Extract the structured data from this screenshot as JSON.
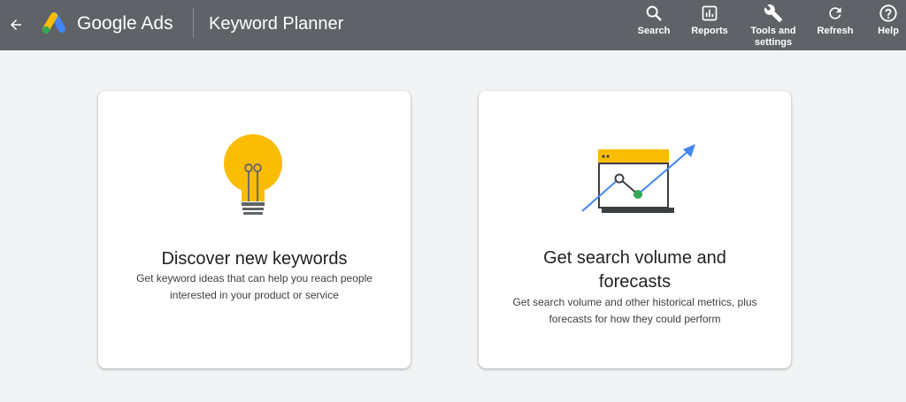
{
  "header": {
    "brand": "Google Ads",
    "page_title": "Keyword Planner",
    "tools": [
      {
        "label": "Search",
        "icon": "search-icon"
      },
      {
        "label": "Reports",
        "icon": "reports-icon"
      },
      {
        "label": "Tools and\nsettings",
        "icon": "wrench-icon"
      },
      {
        "label": "Refresh",
        "icon": "refresh-icon"
      },
      {
        "label": "Help",
        "icon": "help-icon"
      }
    ]
  },
  "cards": [
    {
      "title": "Discover new keywords",
      "description": "Get keyword ideas that can help you reach people interested in your product or service",
      "icon": "lightbulb-icon"
    },
    {
      "title": "Get search volume and forecasts",
      "description": "Get search volume and other historical metrics, plus forecasts for how they could perform",
      "icon": "forecast-chart-icon"
    }
  ],
  "colors": {
    "header_bg": "#5f6368",
    "page_bg": "#f1f3f4",
    "yellow": "#fbbc04",
    "blue": "#4285f4",
    "green": "#34a853"
  }
}
